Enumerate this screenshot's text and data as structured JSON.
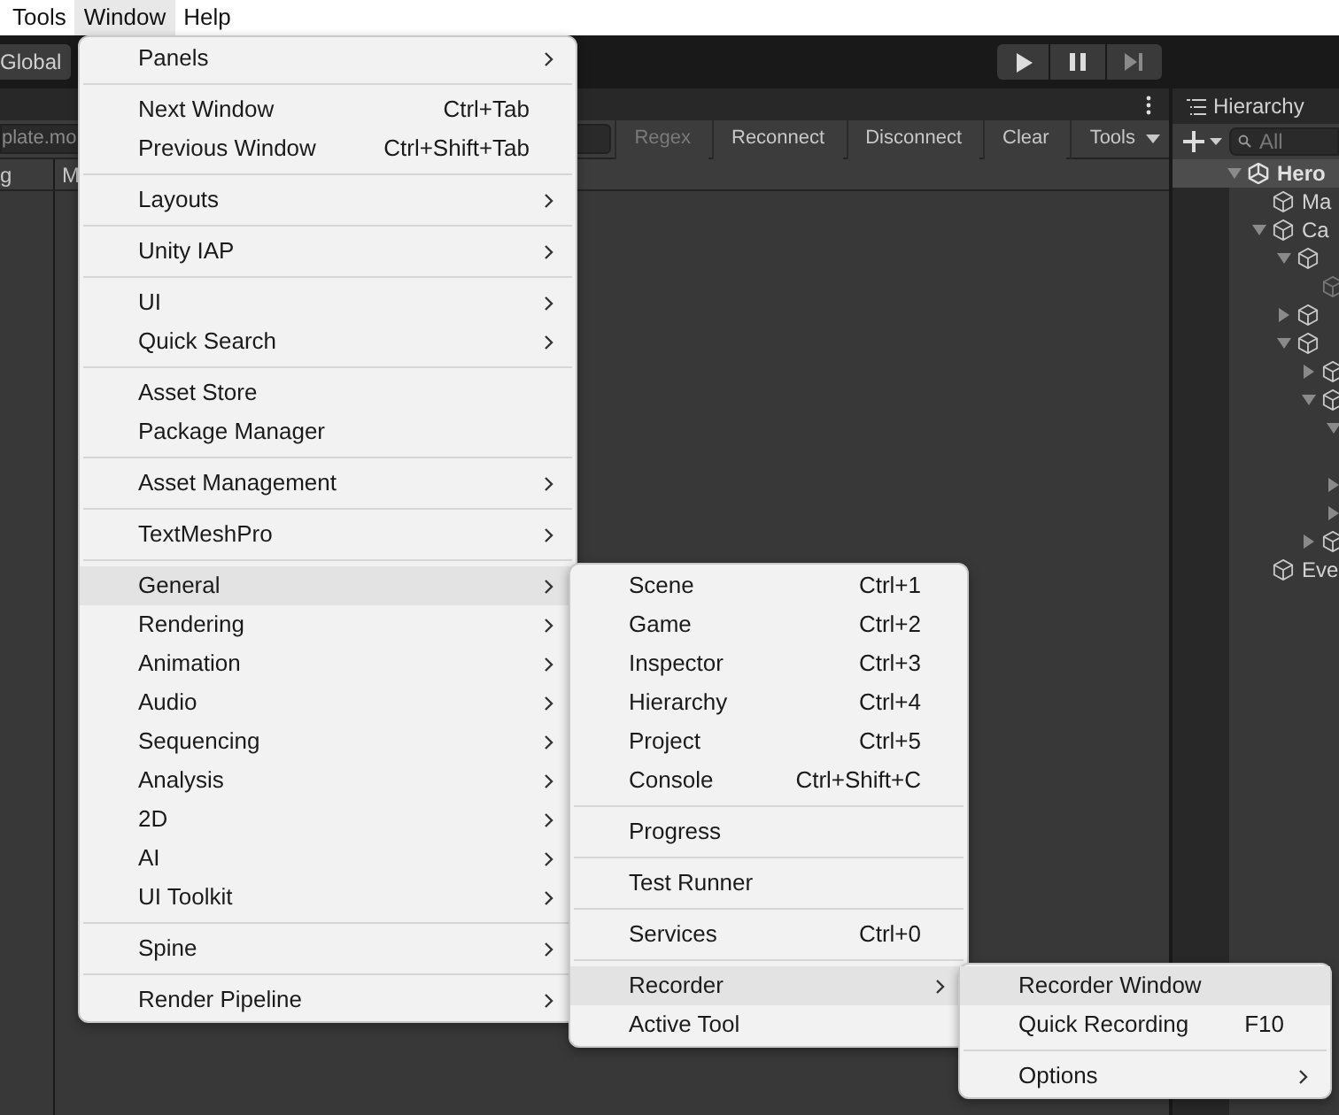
{
  "menubar": [
    {
      "label": "Tools",
      "selected": false
    },
    {
      "label": "Window",
      "selected": true
    },
    {
      "label": "Help",
      "selected": false
    }
  ],
  "toolbar": {
    "global_button": "Global"
  },
  "console": {
    "filter_value": "plate.mo",
    "buttons": [
      {
        "label": "Regex",
        "disabled": true
      },
      {
        "label": "Reconnect",
        "disabled": false
      },
      {
        "label": "Disconnect",
        "disabled": false
      },
      {
        "label": "Clear",
        "disabled": false
      }
    ],
    "tools_dropdown": "Tools",
    "columns": [
      "g",
      "M"
    ]
  },
  "hierarchy": {
    "title": "Hierarchy",
    "search_placeholder": "All",
    "nodes": [
      {
        "kind": "scene",
        "label": "Hero",
        "expanded": true,
        "selected": true,
        "children": [
          {
            "kind": "object",
            "label": "Ma",
            "selected": false
          },
          {
            "kind": "object",
            "label": "Ca",
            "expanded": true,
            "selected": false,
            "children": [
              {
                "kind": "object",
                "expanded": true,
                "selected": false,
                "children": [
                  {
                    "kind": "object",
                    "inactive": true,
                    "selected": false
                  }
                ]
              },
              {
                "kind": "object",
                "expanded": false,
                "selected": false
              },
              {
                "kind": "object",
                "expanded": true,
                "selected": false,
                "children": [
                  {
                    "kind": "object",
                    "expanded": false,
                    "selected": false
                  },
                  {
                    "kind": "object",
                    "expanded": true,
                    "selected": false,
                    "children": [
                      {
                        "expanded": true,
                        "selected": false
                      },
                      {
                        "expanded": false,
                        "selected": false
                      },
                      {
                        "expanded": false,
                        "selected": false
                      }
                    ]
                  },
                  {
                    "kind": "object",
                    "expanded": false,
                    "selected": false
                  }
                ]
              }
            ]
          },
          {
            "kind": "object",
            "label": "Eve",
            "selected": false
          }
        ]
      }
    ]
  },
  "menus": [
    {
      "items": [
        {
          "kind": "item",
          "label": "Panels",
          "submenu": true,
          "highlighted": false
        },
        {
          "kind": "separator"
        },
        {
          "kind": "item",
          "label": "Next Window",
          "shortcut": "Ctrl+Tab",
          "highlighted": false
        },
        {
          "kind": "item",
          "label": "Previous Window",
          "shortcut": "Ctrl+Shift+Tab",
          "highlighted": false
        },
        {
          "kind": "separator"
        },
        {
          "kind": "item",
          "label": "Layouts",
          "submenu": true,
          "highlighted": false
        },
        {
          "kind": "separator"
        },
        {
          "kind": "item",
          "label": "Unity IAP",
          "submenu": true,
          "highlighted": false
        },
        {
          "kind": "separator"
        },
        {
          "kind": "item",
          "label": "UI",
          "submenu": true,
          "highlighted": false
        },
        {
          "kind": "item",
          "label": "Quick Search",
          "submenu": true,
          "highlighted": false
        },
        {
          "kind": "separator"
        },
        {
          "kind": "item",
          "label": "Asset Store",
          "highlighted": false
        },
        {
          "kind": "item",
          "label": "Package Manager",
          "highlighted": false
        },
        {
          "kind": "separator"
        },
        {
          "kind": "item",
          "label": "Asset Management",
          "submenu": true,
          "highlighted": false
        },
        {
          "kind": "separator"
        },
        {
          "kind": "item",
          "label": "TextMeshPro",
          "submenu": true,
          "highlighted": false
        },
        {
          "kind": "separator"
        },
        {
          "kind": "item",
          "label": "General",
          "submenu": true,
          "highlighted": true
        },
        {
          "kind": "item",
          "label": "Rendering",
          "submenu": true,
          "highlighted": false
        },
        {
          "kind": "item",
          "label": "Animation",
          "submenu": true,
          "highlighted": false
        },
        {
          "kind": "item",
          "label": "Audio",
          "submenu": true,
          "highlighted": false
        },
        {
          "kind": "item",
          "label": "Sequencing",
          "submenu": true,
          "highlighted": false
        },
        {
          "kind": "item",
          "label": "Analysis",
          "submenu": true,
          "highlighted": false
        },
        {
          "kind": "item",
          "label": "2D",
          "submenu": true,
          "highlighted": false
        },
        {
          "kind": "item",
          "label": "AI",
          "submenu": true,
          "highlighted": false
        },
        {
          "kind": "item",
          "label": "UI Toolkit",
          "submenu": true,
          "highlighted": false
        },
        {
          "kind": "separator"
        },
        {
          "kind": "item",
          "label": "Spine",
          "submenu": true,
          "highlighted": false
        },
        {
          "kind": "separator"
        },
        {
          "kind": "item",
          "label": "Render Pipeline",
          "submenu": true,
          "highlighted": false
        }
      ]
    },
    {
      "items": [
        {
          "kind": "item",
          "label": "Scene",
          "shortcut": "Ctrl+1",
          "highlighted": false
        },
        {
          "kind": "item",
          "label": "Game",
          "shortcut": "Ctrl+2",
          "highlighted": false
        },
        {
          "kind": "item",
          "label": "Inspector",
          "shortcut": "Ctrl+3",
          "highlighted": false
        },
        {
          "kind": "item",
          "label": "Hierarchy",
          "shortcut": "Ctrl+4",
          "highlighted": false
        },
        {
          "kind": "item",
          "label": "Project",
          "shortcut": "Ctrl+5",
          "highlighted": false
        },
        {
          "kind": "item",
          "label": "Console",
          "shortcut": "Ctrl+Shift+C",
          "highlighted": false
        },
        {
          "kind": "separator"
        },
        {
          "kind": "item",
          "label": "Progress",
          "highlighted": false
        },
        {
          "kind": "separator"
        },
        {
          "kind": "item",
          "label": "Test Runner",
          "highlighted": false
        },
        {
          "kind": "separator"
        },
        {
          "kind": "item",
          "label": "Services",
          "shortcut": "Ctrl+0",
          "highlighted": false
        },
        {
          "kind": "separator"
        },
        {
          "kind": "item",
          "label": "Recorder",
          "submenu": true,
          "highlighted": true
        },
        {
          "kind": "item",
          "label": "Active Tool",
          "highlighted": false
        }
      ]
    },
    {
      "items": [
        {
          "kind": "item",
          "label": "Recorder Window",
          "highlighted": true
        },
        {
          "kind": "item",
          "label": "Quick Recording",
          "shortcut": "F10",
          "highlighted": false
        },
        {
          "kind": "separator"
        },
        {
          "kind": "item",
          "label": "Options",
          "submenu": true,
          "highlighted": false
        }
      ]
    }
  ]
}
